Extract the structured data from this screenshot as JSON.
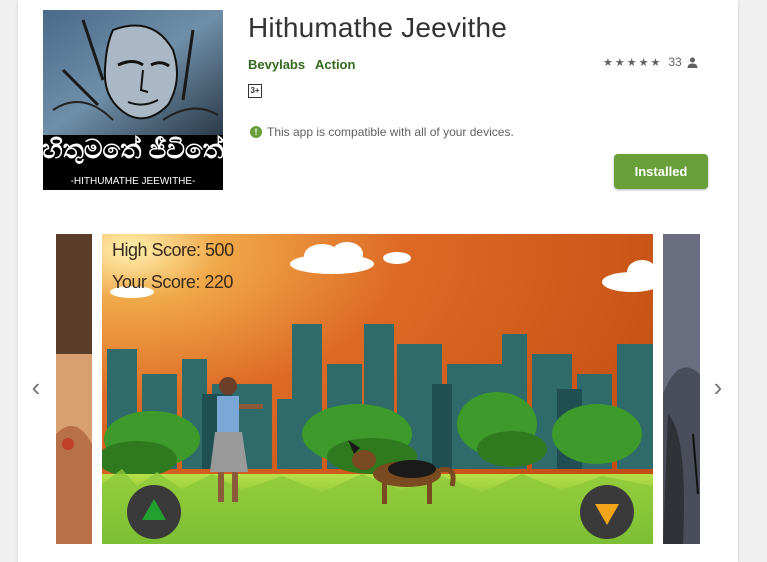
{
  "app": {
    "title": "Hithumathe Jeevithe",
    "developer": "Bevylabs",
    "genre": "Action",
    "rating_count": "33",
    "content_rating": "3+",
    "compatibility_text": "This app is compatible with all of your devices.",
    "install_label": "Installed"
  },
  "icon": {
    "sinhala_title": "හිතුමතේ ජීවිතේ",
    "caption": "-HITHUMATHE JEEWITHE-"
  },
  "screenshot": {
    "high_score": "High Score: 500",
    "your_score": "Your Score: 220"
  },
  "colors": {
    "accent_green": "#689f38",
    "link_green": "#33691e",
    "sky_orange": "#d9621c"
  },
  "icons": [
    "star-icon",
    "person-icon",
    "info-icon",
    "chevron-left-icon",
    "chevron-right-icon",
    "up-arrow-icon",
    "down-arrow-icon"
  ]
}
